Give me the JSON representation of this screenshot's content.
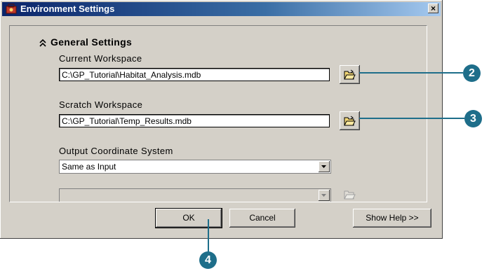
{
  "window": {
    "title": "Environment Settings",
    "close_glyph": "×"
  },
  "section": {
    "title": "General Settings",
    "collapse_glyph": "⌃⌃"
  },
  "fields": {
    "current_workspace": {
      "label": "Current Workspace",
      "value": "C:\\GP_Tutorial\\Habitat_Analysis.mdb"
    },
    "scratch_workspace": {
      "label": "Scratch Workspace",
      "value": "C:\\GP_Tutorial\\Temp_Results.mdb"
    },
    "output_coordinate_system": {
      "label": "Output Coordinate System",
      "value": "Same as Input"
    },
    "coordinate_detail": {
      "value": "",
      "disabled": true
    }
  },
  "buttons": {
    "ok": "OK",
    "cancel": "Cancel",
    "show_help": "Show Help >>"
  },
  "callouts": {
    "c2": "2",
    "c3": "3",
    "c4": "4"
  },
  "colors": {
    "accent": "#1e6e8a",
    "title_bar": "#0a246a",
    "face": "#d4d0c8"
  },
  "icons": [
    "app-toolbox-icon",
    "close-icon",
    "collapse-chevrons-icon",
    "open-folder-icon",
    "dropdown-arrow-icon",
    "scroll-up-icon",
    "scroll-down-icon"
  ]
}
